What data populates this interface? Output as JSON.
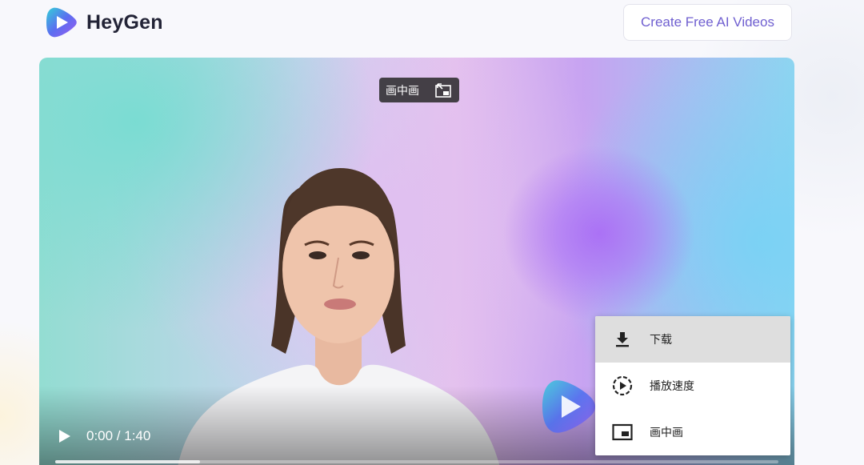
{
  "header": {
    "brand": "HeyGen",
    "cta_label": "Create Free AI Videos"
  },
  "video": {
    "pip_tooltip": "画中画",
    "time": "0:00 / 1:40",
    "progress": 0.2,
    "menu": [
      {
        "label": "下载",
        "icon": "download-icon",
        "active": true
      },
      {
        "label": "播放速度",
        "icon": "playback-speed-icon",
        "active": false
      },
      {
        "label": "画中画",
        "icon": "picture-in-picture-icon",
        "active": false
      }
    ]
  },
  "colors": {
    "accent": "#6f5fd0",
    "brand_text": "#222336",
    "menu_active": "#dedede"
  }
}
